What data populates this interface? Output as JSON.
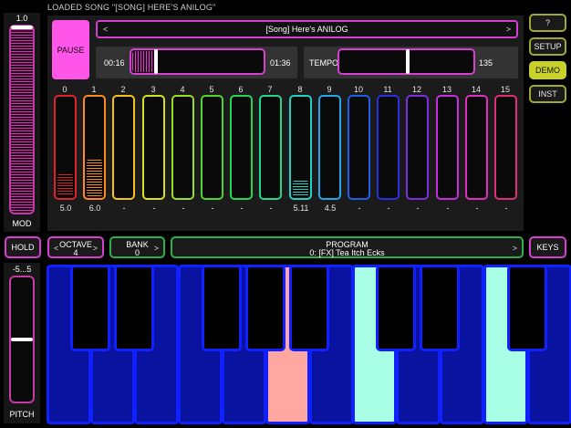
{
  "status": "LOADED SONG \"[SONG] HERE'S ANILOG\"",
  "mod": {
    "value": "1.0",
    "label": "MOD",
    "level": 1.0
  },
  "transport": {
    "pause_label": "PAUSE"
  },
  "song": {
    "name": "[Song] Here's ANILOG",
    "prev": "<",
    "next": ">"
  },
  "position": {
    "elapsed": "00:16",
    "total": "01:36",
    "fraction": 0.167
  },
  "tempo": {
    "label": "TEMPO",
    "value": "135",
    "fraction": 0.5
  },
  "channels": [
    {
      "num": "0",
      "value": "5.0",
      "color": "#e0232b",
      "level": 0.22
    },
    {
      "num": "1",
      "value": "6.0",
      "color": "#ff8a1f",
      "level": 0.37
    },
    {
      "num": "2",
      "value": "-",
      "color": "#f4c21a",
      "level": 0
    },
    {
      "num": "3",
      "value": "-",
      "color": "#d7e21e",
      "level": 0
    },
    {
      "num": "4",
      "value": "-",
      "color": "#97de22",
      "level": 0
    },
    {
      "num": "5",
      "value": "-",
      "color": "#4fd530",
      "level": 0
    },
    {
      "num": "6",
      "value": "-",
      "color": "#26d650",
      "level": 0
    },
    {
      "num": "7",
      "value": "-",
      "color": "#22d68e",
      "level": 0
    },
    {
      "num": "8",
      "value": "5.11",
      "color": "#20d2c6",
      "level": 0.16
    },
    {
      "num": "9",
      "value": "4.5",
      "color": "#22a8e8",
      "level": 0
    },
    {
      "num": "10",
      "value": "-",
      "color": "#1f5fe8",
      "level": 0
    },
    {
      "num": "11",
      "value": "-",
      "color": "#2a2fe0",
      "level": 0
    },
    {
      "num": "12",
      "value": "-",
      "color": "#7a2ee0",
      "level": 0
    },
    {
      "num": "13",
      "value": "-",
      "color": "#c22ee0",
      "level": 0
    },
    {
      "num": "14",
      "value": "-",
      "color": "#e02ec0",
      "level": 0
    },
    {
      "num": "15",
      "value": "-",
      "color": "#e02e7a",
      "level": 0
    }
  ],
  "side": {
    "help": "?",
    "setup": "SETUP",
    "demo": "DEMO",
    "inst": "INST"
  },
  "controls": {
    "hold": "HOLD",
    "octave_label": "OCTAVE",
    "octave_value": "4",
    "bank_label": "BANK",
    "bank_value": "0",
    "program_label": "PROGRAM",
    "program_value": "0: [FX] Tea Itch Ecks",
    "keys": "KEYS",
    "prev": "<",
    "next": ">"
  },
  "pitch": {
    "value": "-5...5",
    "label": "PITCH",
    "level": 0.5
  },
  "keyboard": {
    "white_keys": [
      {
        "state": "normal"
      },
      {
        "state": "normal"
      },
      {
        "state": "normal"
      },
      {
        "state": "normal"
      },
      {
        "state": "normal"
      },
      {
        "state": "pressed-pink"
      },
      {
        "state": "normal"
      },
      {
        "state": "pressed-teal"
      },
      {
        "state": "normal"
      },
      {
        "state": "normal"
      },
      {
        "state": "pressed-teal"
      },
      {
        "state": "normal"
      }
    ],
    "pressed_colors": {
      "pressed-pink": "#ffa7a0",
      "pressed-teal": "#a9ffe5",
      "normal": "#0a12a0"
    }
  }
}
